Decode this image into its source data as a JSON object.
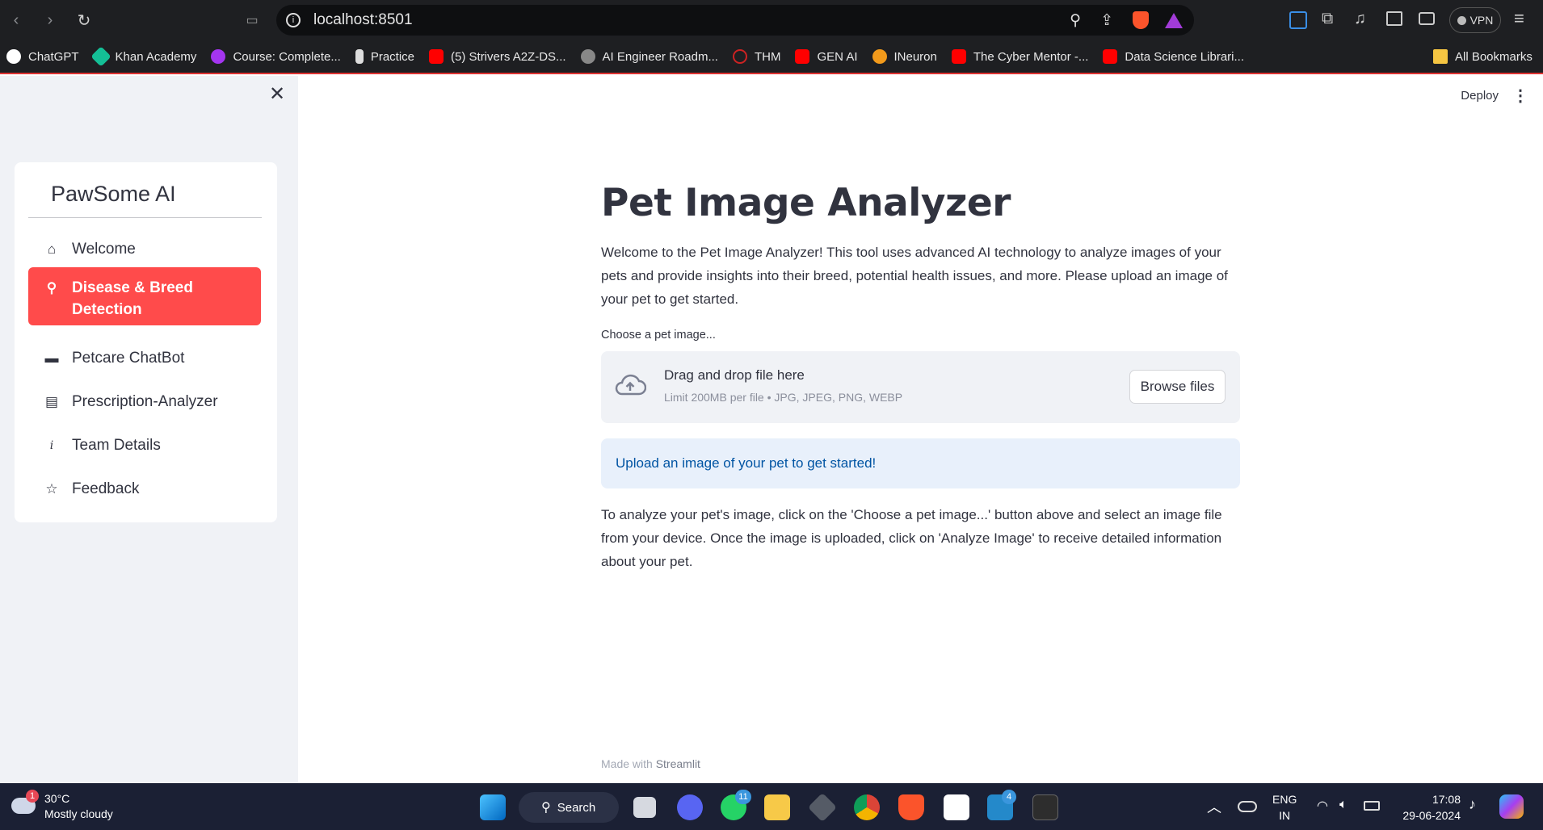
{
  "browser": {
    "url": "localhost:8501",
    "vpn_label": "VPN",
    "bookmarks": [
      "ChatGPT",
      "Khan Academy",
      "Course: Complete...",
      "Practice",
      "(5) Strivers A2Z-DS...",
      "AI Engineer Roadm...",
      "THM",
      "GEN AI",
      "INeuron",
      "The Cyber Mentor -...",
      "Data Science Librari..."
    ],
    "all_bookmarks": "All Bookmarks"
  },
  "header": {
    "deploy_label": "Deploy"
  },
  "sidebar": {
    "title": "PawSome AI",
    "items": [
      {
        "label": "Welcome",
        "icon": "home-icon"
      },
      {
        "label": "Disease & Breed Detection",
        "icon": "search-icon",
        "active": true
      },
      {
        "label": "Petcare ChatBot",
        "icon": "chat-icon"
      },
      {
        "label": "Prescription-Analyzer",
        "icon": "document-icon"
      },
      {
        "label": "Team Details",
        "icon": "info-icon"
      },
      {
        "label": "Feedback",
        "icon": "star-icon"
      }
    ]
  },
  "main": {
    "title": "Pet Image Analyzer",
    "intro": "Welcome to the Pet Image Analyzer! This tool uses advanced AI technology to analyze images of your pets and provide insights into their breed, potential health issues, and more. Please upload an image of your pet to get started.",
    "uploader_label": "Choose a pet image...",
    "drop_text": "Drag and drop file here",
    "drop_limit": "Limit 200MB per file • JPG, JPEG, PNG, WEBP",
    "browse_label": "Browse files",
    "info_text": "Upload an image of your pet to get started!",
    "instructions": "To analyze your pet's image, click on the 'Choose a pet image...' button above and select an image file from your device. Once the image is uploaded, click on 'Analyze Image' to receive detailed information about your pet.",
    "footer_prefix": "Made with ",
    "footer_brand": "Streamlit"
  },
  "taskbar": {
    "weather_temp": "30°C",
    "weather_desc": "Mostly cloudy",
    "weather_badge": "1",
    "search_label": "Search",
    "whatsapp_badge": "11",
    "vscode_badge": "4",
    "lang": "ENG",
    "region": "IN",
    "time": "17:08",
    "date": "29-06-2024"
  },
  "colors": {
    "accent": "#ff4b4b",
    "sidebar_bg": "#f0f2f6",
    "info_bg": "#e8f0fb",
    "info_text": "#0054a3"
  }
}
